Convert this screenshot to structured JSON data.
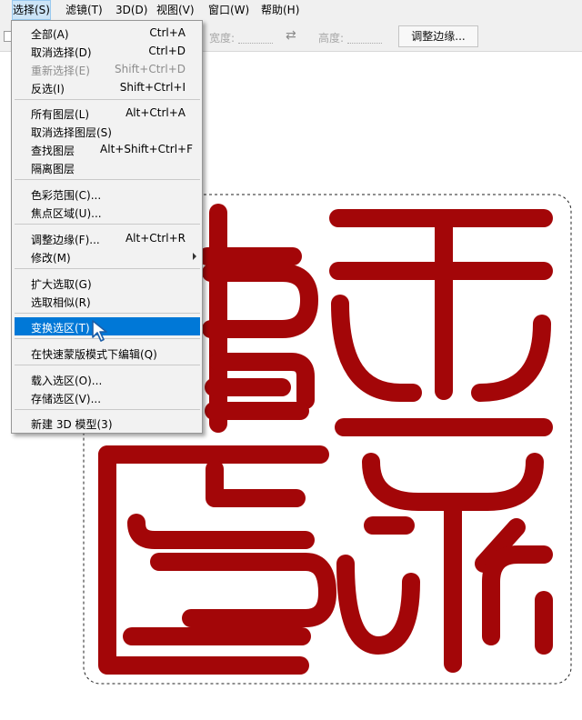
{
  "menubar": {
    "items": [
      "选择(S)",
      "滤镜(T)",
      "3D(D)",
      "视图(V)",
      "窗口(W)",
      "帮助(H)"
    ],
    "active": "选择(S)"
  },
  "options_bar": {
    "width_label": "宽度:",
    "height_label": "高度:",
    "width_value": "",
    "height_value": "",
    "swap_icon": "swap-arrows-icon",
    "refine_edge_button": "调整边缘..."
  },
  "select_menu": {
    "items": [
      {
        "label": "全部(A)",
        "shortcut": "Ctrl+A",
        "disabled": false
      },
      {
        "label": "取消选择(D)",
        "shortcut": "Ctrl+D",
        "disabled": false
      },
      {
        "label": "重新选择(E)",
        "shortcut": "Shift+Ctrl+D",
        "disabled": true
      },
      {
        "label": "反选(I)",
        "shortcut": "Shift+Ctrl+I",
        "disabled": false
      },
      {
        "label": "所有图层(L)",
        "shortcut": "Alt+Ctrl+A",
        "disabled": false
      },
      {
        "label": "取消选择图层(S)",
        "shortcut": "",
        "disabled": false
      },
      {
        "label": "查找图层",
        "shortcut": "Alt+Shift+Ctrl+F",
        "disabled": false
      },
      {
        "label": "隔离图层",
        "shortcut": "",
        "disabled": false
      },
      {
        "label": "色彩范围(C)...",
        "shortcut": "",
        "disabled": false
      },
      {
        "label": "焦点区域(U)...",
        "shortcut": "",
        "disabled": false
      },
      {
        "label": "调整边缘(F)...",
        "shortcut": "Alt+Ctrl+R",
        "disabled": false
      },
      {
        "label": "修改(M)",
        "shortcut": "",
        "disabled": false,
        "submenu": true
      },
      {
        "label": "扩大选取(G)",
        "shortcut": "",
        "disabled": false
      },
      {
        "label": "选取相似(R)",
        "shortcut": "",
        "disabled": false
      },
      {
        "label": "变换选区(T)",
        "shortcut": "",
        "disabled": false,
        "highlighted": true
      },
      {
        "label": "在快速蒙版模式下编辑(Q)",
        "shortcut": "",
        "disabled": false
      },
      {
        "label": "载入选区(O)...",
        "shortcut": "",
        "disabled": false
      },
      {
        "label": "存储选区(V)...",
        "shortcut": "",
        "disabled": false
      },
      {
        "label": "新建 3D 模型(3)",
        "shortcut": "",
        "disabled": false
      }
    ]
  },
  "canvas": {
    "seal_color": "#a30608",
    "highlight_color": "#0078d7",
    "selection_style": "dashed marching ants"
  }
}
